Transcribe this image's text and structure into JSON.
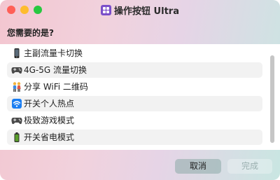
{
  "window": {
    "title": "操作按钮 Ultra",
    "app_icon": "grid-app-icon"
  },
  "prompt": "您需要的是?",
  "items": [
    {
      "icon": "phone-icon",
      "label": "主副流量卡切换"
    },
    {
      "icon": "gamepad-icon",
      "label": "4G-5G 流量切换"
    },
    {
      "icon": "people-icon",
      "label": "分享 WiFi 二维码"
    },
    {
      "icon": "wifi-icon",
      "label": "开关个人热点"
    },
    {
      "icon": "gamepad-icon",
      "label": "极致游戏模式"
    },
    {
      "icon": "battery-icon",
      "label": "开关省电模式"
    }
  ],
  "buttons": {
    "cancel": "取消",
    "done": "完成"
  },
  "colors": {
    "close": "#ff5f57",
    "minimize": "#febc2e",
    "maximize": "#28c840",
    "accent_icon": "#7b4fc9",
    "wifi_blue": "#1a7ef2",
    "battery_green": "#5a9e2a"
  }
}
